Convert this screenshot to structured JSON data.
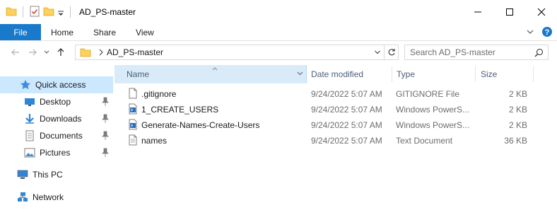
{
  "window": {
    "title": "AD_PS-master"
  },
  "ribbon": {
    "tabs": [
      "File",
      "Home",
      "Share",
      "View"
    ]
  },
  "address": {
    "path": "AD_PS-master"
  },
  "search": {
    "placeholder": "Search AD_PS-master"
  },
  "sidebar": {
    "items": [
      {
        "label": "Quick access",
        "icon": "star-icon"
      },
      {
        "label": "Desktop",
        "icon": "desktop-icon"
      },
      {
        "label": "Downloads",
        "icon": "downloads-icon"
      },
      {
        "label": "Documents",
        "icon": "documents-icon"
      },
      {
        "label": "Pictures",
        "icon": "pictures-icon"
      },
      {
        "label": "This PC",
        "icon": "this-pc-icon"
      },
      {
        "label": "Network",
        "icon": "network-icon"
      }
    ]
  },
  "columns": {
    "name": "Name",
    "date": "Date modified",
    "type": "Type",
    "size": "Size"
  },
  "files": [
    {
      "name": ".gitignore",
      "date": "9/24/2022 5:07 AM",
      "type": "GITIGNORE File",
      "size": "2 KB",
      "icon": "text-file-icon"
    },
    {
      "name": "1_CREATE_USERS",
      "date": "9/24/2022 5:07 AM",
      "type": "Windows PowerS...",
      "size": "2 KB",
      "icon": "powershell-file-icon"
    },
    {
      "name": "Generate-Names-Create-Users",
      "date": "9/24/2022 5:07 AM",
      "type": "Windows PowerS...",
      "size": "2 KB",
      "icon": "powershell-file-icon"
    },
    {
      "name": "names",
      "date": "9/24/2022 5:07 AM",
      "type": "Text Document",
      "size": "36 KB",
      "icon": "text-file-icon"
    }
  ],
  "colors": {
    "accent": "#1979ca",
    "selection": "#cce8ff",
    "header_text": "#4c607a",
    "folder": "#ffd05a"
  }
}
